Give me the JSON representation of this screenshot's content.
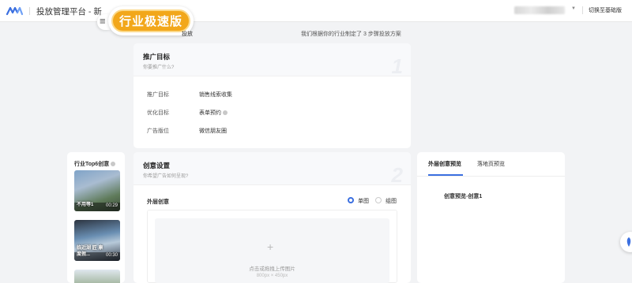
{
  "header": {
    "platform_title": "投放管理平台 - 新",
    "badge_label": "行业极速版",
    "switch_label": "切换至基础版"
  },
  "plan": {
    "left_text": "投放",
    "right_text": "我们根据你的行业制定了 3 步骤投放方案"
  },
  "goal_card": {
    "title": "推广目标",
    "subtitle": "你要推广什么?",
    "step_number": "1",
    "rows": [
      {
        "label": "推广目标",
        "value": "销售线索收集"
      },
      {
        "label": "优化目标",
        "value": "表单预约"
      },
      {
        "label": "广告版位",
        "value": "微信朋友圈"
      }
    ]
  },
  "sidebar": {
    "title": "行业Top6创意",
    "items": [
      {
        "caption": "不用等1",
        "duration": "00:29"
      },
      {
        "caption": "临近湖 匠 康度假...",
        "duration": "00:30"
      }
    ]
  },
  "creative_card": {
    "title": "创意设置",
    "subtitle": "你希望广告如何呈现?",
    "step_number": "2",
    "section_label": "外层创意",
    "radio_single": "单图",
    "radio_multi": "组图",
    "upload_text": "点击或拖拽上传图片",
    "upload_size": "800px × 450px"
  },
  "preview": {
    "tab_outer": "外层创意预览",
    "tab_landing": "落地页预览",
    "title": "创意预览-创意1"
  },
  "colors": {
    "accent": "#3b6fe0",
    "badge": "#f2a71a"
  }
}
